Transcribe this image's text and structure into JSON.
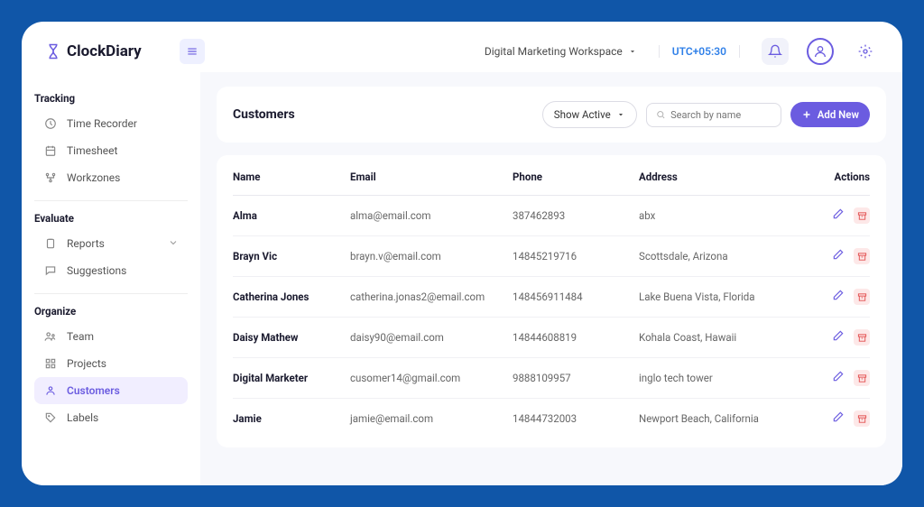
{
  "app_name": "ClockDiary",
  "workspace": "Digital Marketing Workspace",
  "timezone": "UTC+05:30",
  "sidebar": {
    "tracking_label": "Tracking",
    "evaluate_label": "Evaluate",
    "organize_label": "Organize",
    "time_recorder": "Time Recorder",
    "timesheet": "Timesheet",
    "workzones": "Workzones",
    "reports": "Reports",
    "suggestions": "Suggestions",
    "team": "Team",
    "projects": "Projects",
    "customers": "Customers",
    "labels": "Labels"
  },
  "page": {
    "title": "Customers",
    "show_active": "Show Active",
    "search_placeholder": "Search by name",
    "add_new": "Add New"
  },
  "cols": {
    "name": "Name",
    "email": "Email",
    "phone": "Phone",
    "address": "Address",
    "actions": "Actions"
  },
  "rows": [
    {
      "name": "Alma",
      "email": "alma@email.com",
      "phone": "387462893",
      "address": "abx"
    },
    {
      "name": "Brayn Vic",
      "email": "brayn.v@email.com",
      "phone": "14845219716",
      "address": "Scottsdale, Arizona"
    },
    {
      "name": "Catherina Jones",
      "email": "catherina.jonas2@email.com",
      "phone": "148456911484",
      "address": "Lake Buena Vista, Florida"
    },
    {
      "name": "Daisy Mathew",
      "email": "daisy90@email.com",
      "phone": "14844608819",
      "address": "Kohala Coast, Hawaii"
    },
    {
      "name": "Digital Marketer",
      "email": "cusomer14@gmail.com",
      "phone": "9888109957",
      "address": "inglo tech tower"
    },
    {
      "name": "Jamie",
      "email": "jamie@email.com",
      "phone": "14844732003",
      "address": "Newport Beach, California"
    }
  ]
}
